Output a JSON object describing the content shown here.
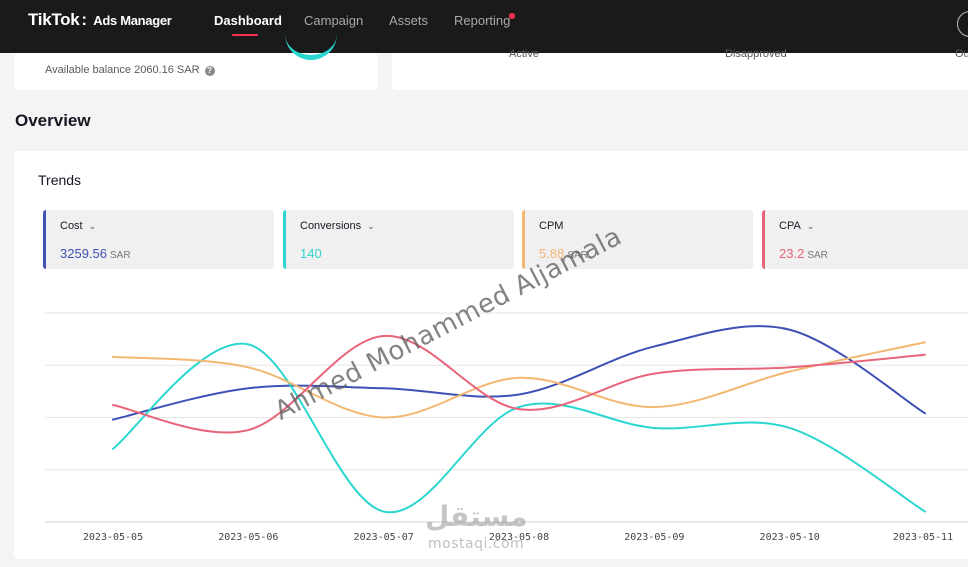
{
  "header": {
    "logo": "TikTok",
    "logo_sep": ":",
    "logo_sub": "Ads Manager",
    "nav": [
      {
        "label": "Dashboard"
      },
      {
        "label": "Campaign"
      },
      {
        "label": "Assets"
      },
      {
        "label": "Reporting"
      }
    ]
  },
  "summary": {
    "balance_label": "Available balance 2060.16 SAR",
    "statuses": [
      {
        "label": "Active"
      },
      {
        "label": "Disapproved"
      },
      {
        "label": "Ou"
      }
    ]
  },
  "overview": {
    "title": "Overview"
  },
  "trends": {
    "title": "Trends",
    "currency": "SAR",
    "metrics": [
      {
        "label": "Cost",
        "value": "3259.56",
        "unit": "SAR",
        "color": "#3f51b5"
      },
      {
        "label": "Conversions",
        "value": "140",
        "unit": "",
        "color": "#2bd6d0"
      },
      {
        "label": "CPM",
        "value": "5.88",
        "unit": "SAR",
        "color": "#f2b872"
      },
      {
        "label": "CPA",
        "value": "23.2",
        "unit": "SAR",
        "color": "#e8647a"
      }
    ]
  },
  "chart_data": {
    "type": "line",
    "x": [
      "2023-05-05",
      "2023-05-06",
      "2023-05-07",
      "2023-05-08",
      "2023-05-09",
      "2023-05-10",
      "2023-05-11"
    ],
    "ylim": [
      0,
      100
    ],
    "grid": true,
    "series": [
      {
        "name": "Cost",
        "color": "#3f51b5",
        "values": [
          49,
          64,
          64,
          61,
          84,
          92,
          52
        ]
      },
      {
        "name": "Conversions",
        "color": "#2bd6d0",
        "values": [
          35,
          85,
          5,
          55,
          45,
          45,
          5
        ]
      },
      {
        "name": "CPM",
        "color": "#f2b872",
        "values": [
          79,
          74,
          50,
          69,
          55,
          72,
          86
        ]
      },
      {
        "name": "CPA",
        "color": "#e8647a",
        "values": [
          56,
          44,
          89,
          54,
          71,
          74,
          80
        ]
      }
    ]
  },
  "watermark": {
    "text": "Ahmed Mohammed Aljamala",
    "brand_ar": "مستقل",
    "brand_en": "mostaqi.com"
  }
}
